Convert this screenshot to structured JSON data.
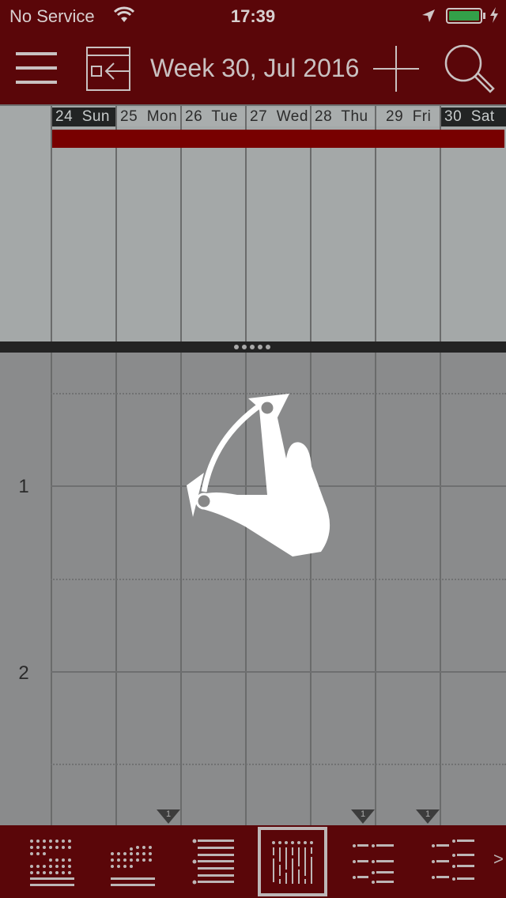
{
  "status_bar": {
    "carrier": "No Service",
    "time": "17:39",
    "icons": [
      "wifi-icon",
      "location-arrow-icon",
      "battery-icon",
      "charging-bolt-icon"
    ],
    "battery_color": "#33a049"
  },
  "nav": {
    "title": "Week 30, Jul 2016",
    "icons": [
      "menu-icon",
      "back-to-today-icon",
      "add-icon",
      "search-icon"
    ],
    "background": "#5a0609"
  },
  "week": {
    "days": [
      {
        "label": "24  Sun",
        "highlight": true
      },
      {
        "label": "25  Mon",
        "highlight": false
      },
      {
        "label": "26  Tue",
        "highlight": false
      },
      {
        "label": "27  Wed",
        "highlight": false
      },
      {
        "label": "28  Thu",
        "highlight": false
      },
      {
        "label": "29  Fri",
        "highlight": false
      },
      {
        "label": "30  Sat",
        "highlight": true
      }
    ],
    "all_day_event_color": "#780000"
  },
  "time_grid": {
    "hours": [
      "1",
      "2"
    ],
    "overflow_markers": [
      {
        "day": "25 Mon",
        "count": "1"
      },
      {
        "day": "28 Thu",
        "count": "1"
      },
      {
        "day": "29 Fri",
        "count": "1"
      }
    ]
  },
  "gesture_hint": "pinch-rotate-gesture",
  "toolbar": {
    "views": [
      {
        "name": "month-grid-view",
        "active": false
      },
      {
        "name": "month-list-view",
        "active": false
      },
      {
        "name": "list-view",
        "active": false
      },
      {
        "name": "week-view",
        "active": true
      },
      {
        "name": "day-list-view",
        "active": false
      },
      {
        "name": "agenda-view",
        "active": false
      }
    ],
    "more_label": ">"
  }
}
